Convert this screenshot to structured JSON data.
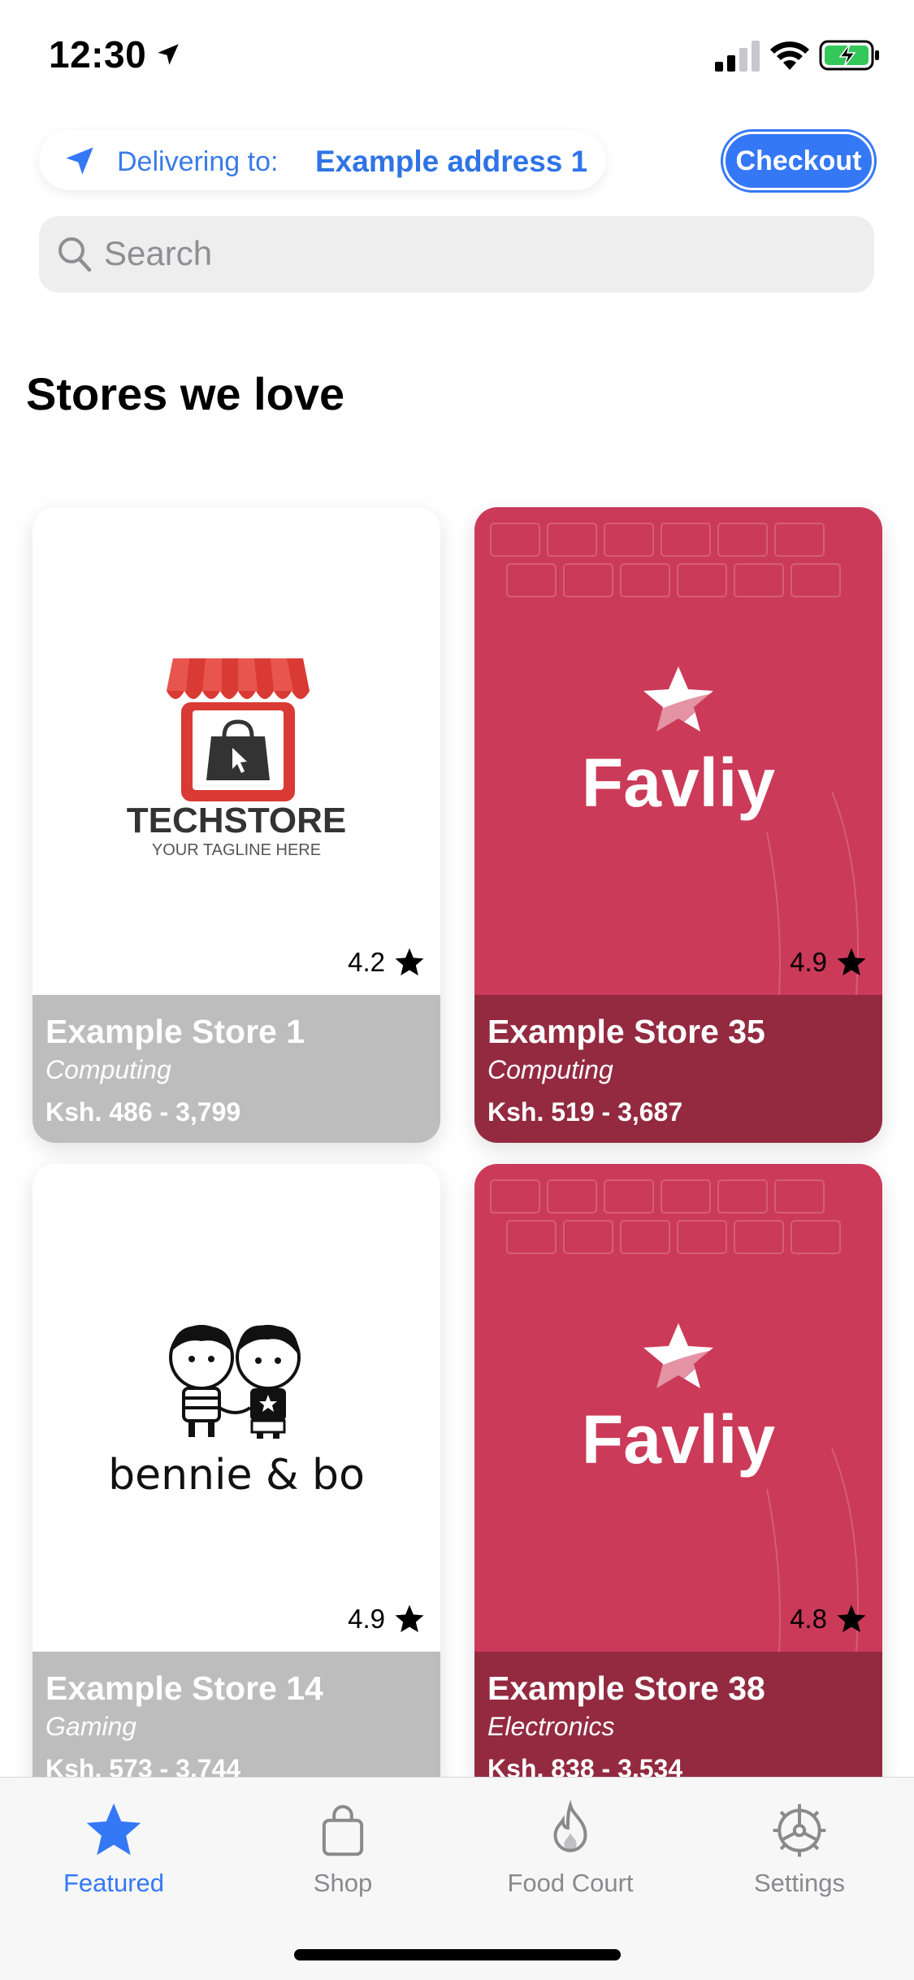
{
  "status_bar": {
    "time": "12:30"
  },
  "delivery": {
    "label": "Delivering to:",
    "address": "Example address 1"
  },
  "checkout_label": "Checkout",
  "search": {
    "placeholder": "Search"
  },
  "section_title": "Stores we love",
  "stores": [
    {
      "logo_text": "TECHSTORE",
      "logo_tagline": "YOUR TAGLINE HERE",
      "rating": "4.2",
      "name": "Example Store 1",
      "category": "Computing",
      "price_range": "Ksh. 486 - 3,799"
    },
    {
      "logo_text": "Favliy",
      "rating": "4.9",
      "name": "Example Store 35",
      "category": "Computing",
      "price_range": "Ksh. 519 - 3,687"
    },
    {
      "logo_text": "bennie & bo",
      "rating": "4.9",
      "name": "Example Store 14",
      "category": "Gaming",
      "price_range": "Ksh. 573 - 3,744"
    },
    {
      "logo_text": "Favliy",
      "rating": "4.8",
      "name": "Example Store 38",
      "category": "Electronics",
      "price_range": "Ksh. 838 - 3,534"
    }
  ],
  "tabs": [
    {
      "label": "Featured",
      "icon": "star-icon",
      "active": true
    },
    {
      "label": "Shop",
      "icon": "shopping-bag-icon",
      "active": false
    },
    {
      "label": "Food Court",
      "icon": "flame-icon",
      "active": false
    },
    {
      "label": "Settings",
      "icon": "gear-icon",
      "active": false
    }
  ],
  "colors": {
    "accent": "#3478f6",
    "card_red": "#cc3a59",
    "card_red_footer": "#932a40",
    "card_grey_footer": "#bdbdbd"
  }
}
